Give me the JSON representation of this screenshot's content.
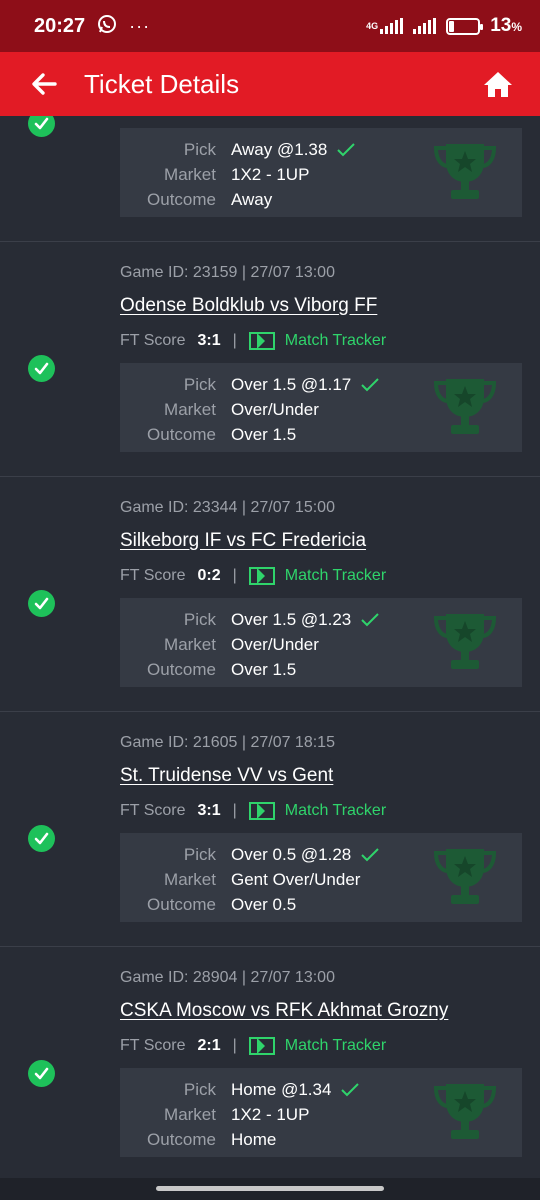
{
  "status_bar": {
    "time": "20:27",
    "network": "4G",
    "battery_percent": "13",
    "battery_unit": "%"
  },
  "header": {
    "title": "Ticket Details"
  },
  "labels": {
    "ft_score": "FT Score",
    "pick": "Pick",
    "market": "Market",
    "outcome": "Outcome",
    "match_tracker": "Match Tracker",
    "separator": "|"
  },
  "games": [
    {
      "game_id": "",
      "teams": "",
      "ft_score": "",
      "pick": "Away @1.38",
      "market": "1X2 - 1UP",
      "outcome": "Away",
      "result": "won"
    },
    {
      "game_id": "Game ID: 23159 | 27/07 13:00",
      "teams": "Odense Boldklub vs Viborg FF",
      "ft_score": "3:1",
      "pick": "Over 1.5 @1.17",
      "market": "Over/Under",
      "outcome": "Over 1.5",
      "result": "won"
    },
    {
      "game_id": "Game ID: 23344 | 27/07 15:00",
      "teams": "Silkeborg IF vs FC Fredericia",
      "ft_score": "0:2",
      "pick": "Over 1.5 @1.23",
      "market": "Over/Under",
      "outcome": "Over 1.5",
      "result": "won"
    },
    {
      "game_id": "Game ID: 21605 | 27/07 18:15",
      "teams": "St. Truidense VV vs Gent",
      "ft_score": "3:1",
      "pick": "Over 0.5 @1.28",
      "market": "Gent Over/Under",
      "outcome": "Over 0.5",
      "result": "won"
    },
    {
      "game_id": "Game ID: 28904 | 27/07 13:00",
      "teams": "CSKA Moscow vs RFK Akhmat Grozny",
      "ft_score": "2:1",
      "pick": "Home @1.34",
      "market": "1X2 - 1UP",
      "outcome": "Home",
      "result": "won"
    }
  ],
  "colors": {
    "status_bar": "#8e0e18",
    "app_bar": "#e21b25",
    "background": "#282c35",
    "card": "#353a44",
    "success": "#1ec15a",
    "tracker": "#2fd46b",
    "trophy": "#1d5a35"
  }
}
